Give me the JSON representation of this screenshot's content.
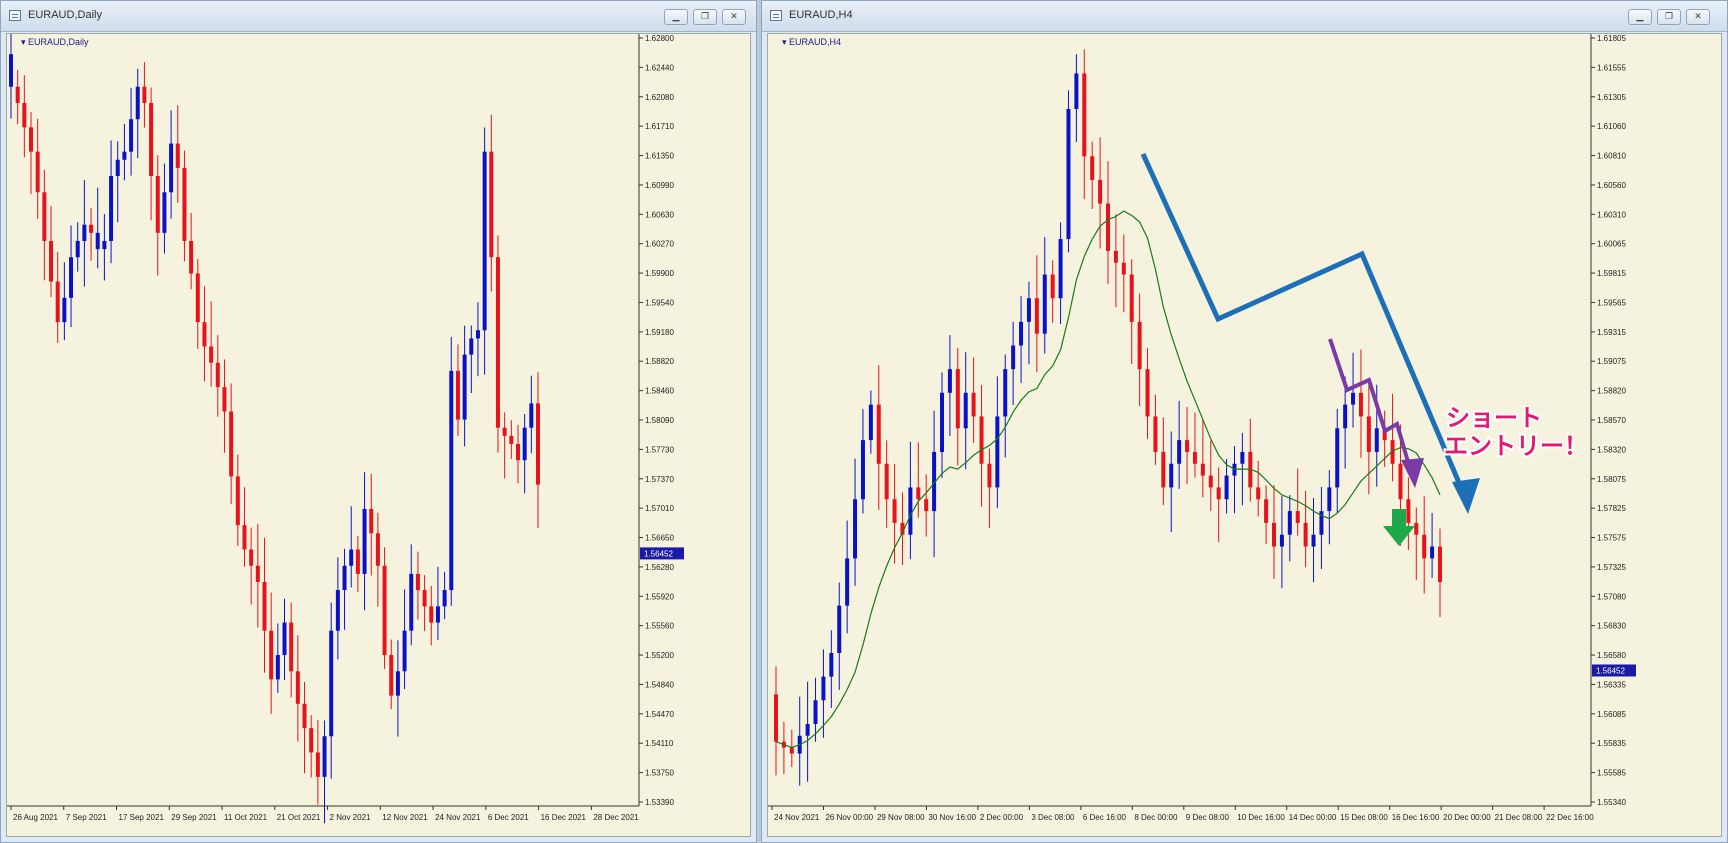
{
  "windows": {
    "left": {
      "title": "EURAUD,Daily",
      "symbol_label": "EURAUD,Daily",
      "buttons": [
        "minimize",
        "restore",
        "close"
      ]
    },
    "right": {
      "title": "EURAUD,H4",
      "symbol_label": "EURAUD,H4",
      "buttons": [
        "minimize",
        "restore",
        "close"
      ]
    }
  },
  "annotation": {
    "line1": "ショート",
    "line2": "エントリー！"
  },
  "colors": {
    "bull": "#0a12c8",
    "bear": "#e8121a",
    "background": "#f5f3dd",
    "ma": "#1a7a1a",
    "blue_arrow": "#1d6fb8",
    "purple_arrow": "#7a3aa8",
    "green_arrow": "#1fa84a",
    "price_marker": "#1a1aa8"
  },
  "chart_data": [
    {
      "type": "candlestick",
      "symbol": "EURAUD",
      "timeframe": "Daily",
      "ylim": [
        1.5339,
        1.628
      ],
      "y_ticks": [
        "1.62800",
        "1.62440",
        "1.62080",
        "1.61710",
        "1.61350",
        "1.60990",
        "1.60630",
        "1.60270",
        "1.59900",
        "1.59540",
        "1.59180",
        "1.58820",
        "1.58460",
        "1.58090",
        "1.57730",
        "1.57370",
        "1.57010",
        "1.56650",
        "1.56280",
        "1.55920",
        "1.55560",
        "1.55200",
        "1.54840",
        "1.54470",
        "1.54110",
        "1.53750",
        "1.53390"
      ],
      "x_ticks": [
        "26 Aug 2021",
        "7 Sep 2021",
        "17 Sep 2021",
        "29 Sep 2021",
        "11 Oct 2021",
        "21 Oct 2021",
        "2 Nov 2021",
        "12 Nov 2021",
        "24 Nov 2021",
        "6 Dec 2021",
        "16 Dec 2021",
        "28 Dec 2021"
      ],
      "current_price": "1.56452",
      "current_price_value": 1.56452,
      "closes": [
        1.622,
        1.62,
        1.617,
        1.614,
        1.609,
        1.603,
        1.598,
        1.593,
        1.596,
        1.601,
        1.603,
        1.605,
        1.604,
        1.602,
        1.603,
        1.611,
        1.613,
        1.614,
        1.618,
        1.622,
        1.62,
        1.611,
        1.604,
        1.609,
        1.615,
        1.612,
        1.603,
        1.599,
        1.593,
        1.59,
        1.588,
        1.585,
        1.582,
        1.574,
        1.568,
        1.565,
        1.563,
        1.561,
        1.555,
        1.549,
        1.552,
        1.556,
        1.55,
        1.546,
        1.543,
        1.54,
        1.537,
        1.542,
        1.555,
        1.56,
        1.563,
        1.565,
        1.562,
        1.57,
        1.567,
        1.563,
        1.552,
        1.547,
        1.55,
        1.555,
        1.562,
        1.56,
        1.558,
        1.556,
        1.558,
        1.56,
        1.587,
        1.581,
        1.589,
        1.591,
        1.592,
        1.614,
        1.601,
        1.58,
        1.579,
        1.578,
        1.576,
        1.58,
        1.583,
        1.573
      ],
      "price_down": [
        false,
        true,
        true,
        true,
        true,
        true,
        true,
        true,
        false,
        false,
        false,
        false,
        true,
        false,
        false,
        false,
        false,
        false,
        false,
        false,
        true,
        true,
        true,
        false,
        false,
        true,
        true,
        true,
        true,
        true,
        true,
        true,
        true,
        true,
        true,
        true,
        true,
        true,
        true,
        true,
        false,
        false,
        true,
        true,
        true,
        true,
        true,
        false,
        false,
        false,
        false,
        false,
        true,
        false,
        true,
        true,
        true,
        true,
        false,
        false,
        false,
        true,
        true,
        true,
        false,
        false,
        false,
        true,
        false,
        false,
        false,
        false,
        true,
        true,
        true,
        true,
        true,
        false,
        false,
        true
      ]
    },
    {
      "type": "candlestick",
      "symbol": "EURAUD",
      "timeframe": "H4",
      "ylim": [
        1.5534,
        1.618
      ],
      "y_ticks": [
        "1.61805",
        "1.61555",
        "1.61305",
        "1.61060",
        "1.60810",
        "1.60560",
        "1.60310",
        "1.60065",
        "1.59815",
        "1.59565",
        "1.59315",
        "1.59075",
        "1.58820",
        "1.58570",
        "1.58320",
        "1.58075",
        "1.57825",
        "1.57575",
        "1.57325",
        "1.57080",
        "1.56830",
        "1.56580",
        "1.56335",
        "1.56085",
        "1.55835",
        "1.55585",
        "1.55340"
      ],
      "x_ticks": [
        "24 Nov 2021",
        "26 Nov 00:00",
        "29 Nov 08:00",
        "30 Nov 16:00",
        "2 Dec 00:00",
        "3 Dec 08:00",
        "6 Dec 16:00",
        "8 Dec 00:00",
        "9 Dec 08:00",
        "10 Dec 16:00",
        "14 Dec 00:00",
        "15 Dec 08:00",
        "16 Dec 16:00",
        "20 Dec 00:00",
        "21 Dec 08:00",
        "22 Dec 16:00"
      ],
      "current_price": "1.56452",
      "current_price_value": 1.56452,
      "has_moving_average": true
    }
  ]
}
